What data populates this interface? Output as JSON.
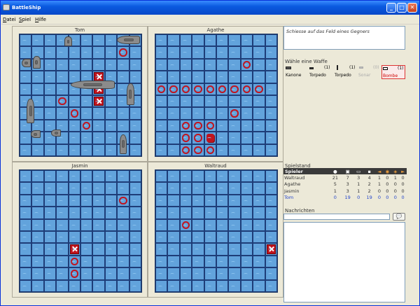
{
  "window": {
    "title": "BattleShip",
    "menus": [
      "Datei",
      "Spiel",
      "Hilfe"
    ],
    "menu_mnemonics": [
      "D",
      "S",
      "H"
    ]
  },
  "boards": {
    "tom": {
      "name": "Tom",
      "misses": [
        [
          3,
          6
        ],
        [
          4,
          7
        ],
        [
          5,
          8
        ],
        [
          8,
          2
        ]
      ],
      "hits": [
        [
          6,
          4
        ],
        [
          6,
          5
        ],
        [
          6,
          6
        ]
      ],
      "blasts": []
    },
    "agathe": {
      "name": "Agathe",
      "misses": [
        [
          7,
          3
        ],
        [
          0,
          5
        ],
        [
          1,
          5
        ],
        [
          2,
          5
        ],
        [
          3,
          5
        ],
        [
          4,
          5
        ],
        [
          5,
          5
        ],
        [
          6,
          5
        ],
        [
          7,
          5
        ],
        [
          8,
          5
        ],
        [
          6,
          7
        ],
        [
          2,
          8
        ],
        [
          3,
          8
        ],
        [
          4,
          8
        ],
        [
          2,
          9
        ],
        [
          3,
          9
        ],
        [
          2,
          10
        ],
        [
          3,
          10
        ],
        [
          4,
          10
        ]
      ],
      "hits": [],
      "blasts": [
        [
          4,
          9
        ]
      ]
    },
    "jasmin": {
      "name": "Jasmin",
      "misses": [
        [
          8,
          3
        ],
        [
          4,
          8
        ],
        [
          4,
          9
        ]
      ],
      "hits": [
        [
          4,
          7
        ]
      ],
      "blasts": []
    },
    "waltraud": {
      "name": "Waltraud",
      "misses": [
        [
          2,
          5
        ]
      ],
      "hits": [
        [
          9,
          7
        ]
      ],
      "blasts": []
    }
  },
  "status_text": "Schiesse auf das Feld eines Gegners",
  "weapons": {
    "title": "Wähle eine Waffe",
    "items": [
      {
        "name": "Kanone",
        "count": "",
        "icon": "cannon-icon"
      },
      {
        "name": "Torpedo",
        "count": "(1)",
        "icon": "torpedo-h-icon"
      },
      {
        "name": "Torpedo",
        "count": "(1)",
        "icon": "torpedo-v-icon"
      },
      {
        "name": "Sonar",
        "count": "(0)",
        "icon": "sonar-icon"
      },
      {
        "name": "Bombe",
        "count": "(1)",
        "icon": "bomb-icon"
      }
    ],
    "selected": "Bombe"
  },
  "scores": {
    "title": "Spielstand",
    "header": "Spieler",
    "rows": [
      {
        "name": "Waltraud",
        "vals": [
          "21",
          "7",
          "3",
          "4",
          "1",
          "0",
          "1",
          "0"
        ]
      },
      {
        "name": "Agathe",
        "vals": [
          "5",
          "3",
          "1",
          "2",
          "1",
          "0",
          "0",
          "0"
        ]
      },
      {
        "name": "Jasmin",
        "vals": [
          "1",
          "3",
          "1",
          "2",
          "0",
          "0",
          "0",
          "0"
        ]
      },
      {
        "name": "Tom",
        "vals": [
          "0",
          "19",
          "0",
          "19",
          "0",
          "0",
          "0",
          "0"
        ]
      }
    ]
  },
  "messages": {
    "title": "Nachrichten",
    "input_value": "",
    "log": []
  },
  "colors": {
    "water": "#62a3dc",
    "grid": "#1e3d78",
    "marker_red": "#c0141e",
    "me_blue": "#2244cc"
  }
}
